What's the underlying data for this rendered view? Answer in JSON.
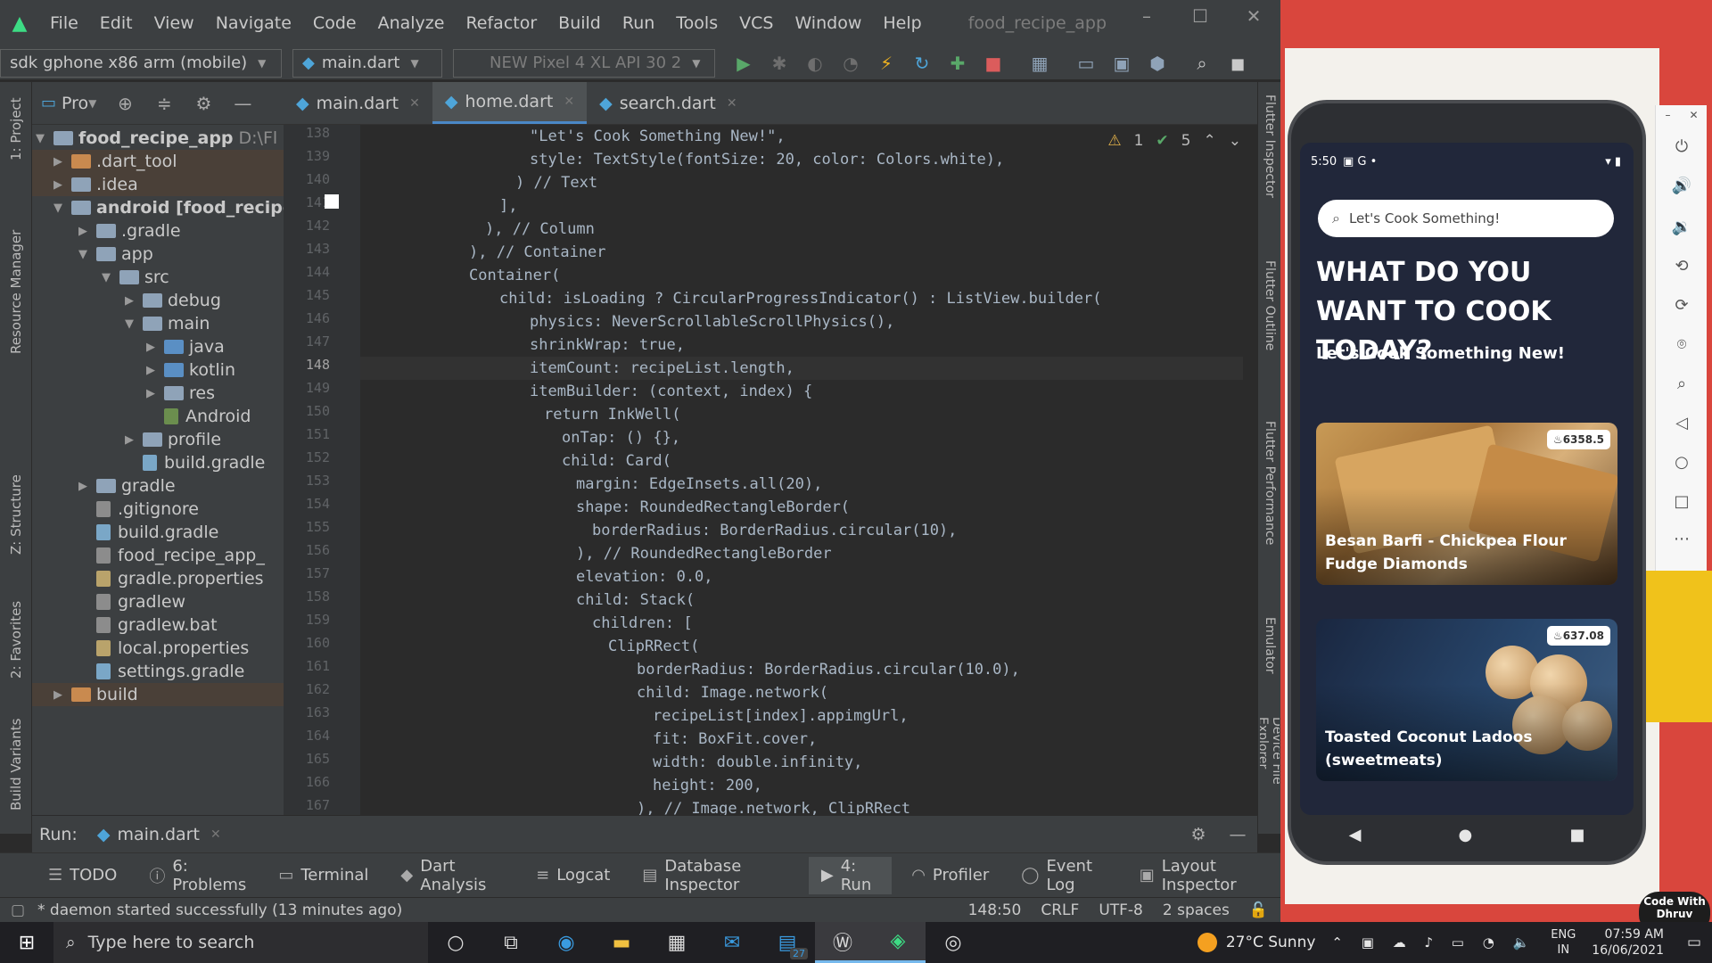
{
  "ide": {
    "menu": [
      "File",
      "Edit",
      "View",
      "Navigate",
      "Code",
      "Analyze",
      "Refactor",
      "Build",
      "Run",
      "Tools",
      "VCS",
      "Window",
      "Help"
    ],
    "project_title": "food_recipe_app",
    "device_combo": "sdk gphone x86 arm (mobile)",
    "config_combo": "main.dart",
    "avd_combo": "NEW Pixel 4 XL API 30 2",
    "panel_label": "Pro",
    "tree": [
      {
        "label": "food_recipe_app",
        "suffix": "D:\\Fl"
      },
      {
        "label": ".dart_tool"
      },
      {
        "label": ".idea"
      },
      {
        "label": "android [food_recipe"
      },
      {
        "label": ".gradle"
      },
      {
        "label": "app"
      },
      {
        "label": "src"
      },
      {
        "label": "debug"
      },
      {
        "label": "main"
      },
      {
        "label": "java"
      },
      {
        "label": "kotlin"
      },
      {
        "label": "res"
      },
      {
        "label": "Android"
      },
      {
        "label": "profile"
      },
      {
        "label": "build.gradle"
      },
      {
        "label": "gradle"
      },
      {
        "label": ".gitignore"
      },
      {
        "label": "build.gradle"
      },
      {
        "label": "food_recipe_app_"
      },
      {
        "label": "gradle.properties"
      },
      {
        "label": "gradlew"
      },
      {
        "label": "gradlew.bat"
      },
      {
        "label": "local.properties"
      },
      {
        "label": "settings.gradle"
      },
      {
        "label": "build"
      }
    ],
    "tabs": [
      "main.dart",
      "home.dart",
      "search.dart"
    ],
    "inspections": {
      "warnings": "1",
      "checks": "5"
    },
    "line_numbers": [
      "138",
      "139",
      "140",
      "141",
      "142",
      "143",
      "144",
      "145",
      "146",
      "147",
      "148",
      "149",
      "150",
      "151",
      "152",
      "153",
      "154",
      "155",
      "156",
      "157",
      "158",
      "159",
      "160",
      "161",
      "162",
      "163",
      "164",
      "165",
      "166",
      "167"
    ],
    "code": [
      "\"Let's Cook Something New!\",",
      "style: TextStyle(fontSize: 20, color: Colors.white),",
      ") // Text",
      "],",
      "), // Column",
      "), // Container",
      "Container(",
      "child: isLoading ? CircularProgressIndicator() : ListView.builder(",
      "physics: NeverScrollableScrollPhysics(),",
      "shrinkWrap: true,",
      "itemCount: recipeList.length,",
      "itemBuilder: (context, index) {",
      "return InkWell(",
      "onTap: () {},",
      "child: Card(",
      "margin: EdgeInsets.all(20),",
      "shape: RoundedRectangleBorder(",
      "borderRadius: BorderRadius.circular(10),",
      "), // RoundedRectangleBorder",
      "elevation: 0.0,",
      "child: Stack(",
      "children: [",
      "ClipRRect(",
      "borderRadius: BorderRadius.circular(10.0),",
      "child: Image.network(",
      "recipeList[index].appimgUrl,",
      "fit: BoxFit.cover,",
      "width: double.infinity,",
      "height: 200,",
      "), // Image.network, ClipRRect"
    ],
    "run_label": "Run:",
    "run_config": "main.dart",
    "tool_tabs": [
      "TODO",
      "6: Problems",
      "Terminal",
      "Dart Analysis",
      "Logcat",
      "Database Inspector",
      "4: Run",
      "Profiler",
      "Event Log",
      "Layout Inspector"
    ],
    "status_message": "* daemon started successfully (13 minutes ago)",
    "status_position": "148:50",
    "status_line_sep": "CRLF",
    "status_encoding": "UTF-8",
    "status_indent": "2 spaces",
    "left_vertical_tabs": [
      "1: Project",
      "Resource Manager",
      "Z: Structure",
      "2: Favorites",
      "Build Variants"
    ],
    "right_vertical_tabs": [
      "Flutter Inspector",
      "Flutter Outline",
      "Flutter Performance",
      "Emulator",
      "Device File Explorer"
    ]
  },
  "phone": {
    "time": "5:50",
    "search_placeholder": "Let's Cook Something!",
    "headline": "WHAT DO YOU WANT TO COOK TODAY?",
    "subhead": "Let's Cook Something New!",
    "cards": [
      {
        "title": "Besan Barfi - Chickpea Flour Fudge Diamonds",
        "calories": "6358.5"
      },
      {
        "title": "Toasted Coconut Ladoos (sweetmeats)",
        "calories": "637.08"
      }
    ]
  },
  "watermark": "Code With Dhruv",
  "taskbar": {
    "search_placeholder": "Type here to search",
    "badge_count": "27",
    "weather": "27°C  Sunny",
    "lang_top": "ENG",
    "lang_bottom": "IN",
    "time": "07:59 AM",
    "date": "16/06/2021"
  },
  "colors": {
    "ide_bg": "#2b2b2b",
    "panel_bg": "#3c3f41",
    "app_bg": "#21273a",
    "emulator_frame": "#d9463d",
    "accent_blue": "#4a88c7"
  }
}
